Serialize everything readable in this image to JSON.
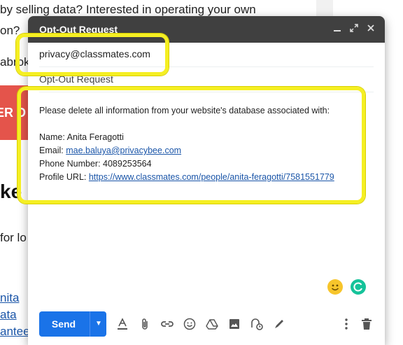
{
  "background": {
    "lines": [
      "by selling data? Interested in operating your own",
      "on?",
      "abrok",
      "ke",
      "for lo"
    ],
    "banner": "ER D",
    "links": [
      "nita",
      "ata",
      "antees"
    ]
  },
  "compose": {
    "title": "Opt-Out Request",
    "to": "privacy@classmates.com",
    "subject": "Opt-Out Request",
    "body": {
      "intro": "Please delete all information from your website's database associated with:",
      "name_label": "Name: ",
      "name": "Anita Feragotti",
      "email_label": "Email: ",
      "email": "mae.baluya@privacybee.com",
      "phone_label": "Phone Number: ",
      "phone": "4089253564",
      "url_label": "Profile URL: ",
      "url": "https://www.classmates.com/people/anita-feragotti/7581551779"
    },
    "send_label": "Send"
  },
  "icons": {
    "minimize": "minimize-icon",
    "expand": "expand-icon",
    "close": "close-icon",
    "formatting": "text-format-icon",
    "attach": "attachment-icon",
    "link": "link-icon",
    "emoji": "emoji-icon",
    "drive": "drive-icon",
    "photo": "photo-icon",
    "confidential": "confidential-mode-icon",
    "signature": "signature-icon",
    "more": "more-options-icon",
    "discard": "trash-icon"
  },
  "colors": {
    "titlebar": "#404040",
    "send": "#1a73e8",
    "highlight": "#f5ef23",
    "link": "#1a55a8"
  }
}
